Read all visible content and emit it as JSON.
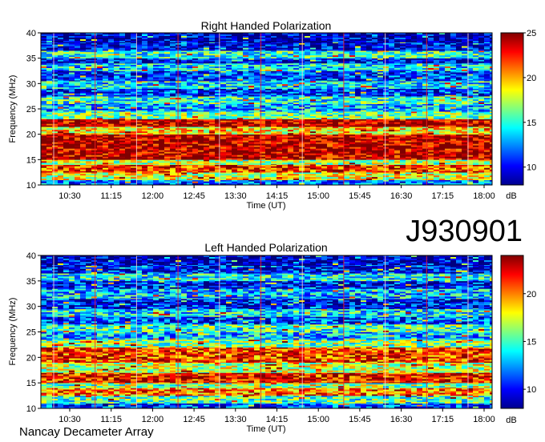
{
  "observation_id": "J930901",
  "footer_text": "Nancay Decameter Array",
  "chart_data": [
    {
      "type": "heatmap",
      "title": "Right Handed Polarization",
      "xlabel": "Time (UT)",
      "ylabel": "Frequency (MHz)",
      "xticks": [
        "10:30",
        "11:15",
        "12:00",
        "12:45",
        "13:30",
        "14:15",
        "15:00",
        "15:45",
        "16:30",
        "17:15",
        "18:00"
      ],
      "yticks": [
        10,
        15,
        20,
        25,
        30,
        35,
        40
      ],
      "ylim": [
        10,
        40
      ],
      "colorbar": {
        "label": "dB",
        "ticks": [
          10,
          15,
          20,
          25
        ],
        "range": [
          8,
          25
        ]
      },
      "colormap": "jet",
      "bands": [
        {
          "freq": [
            10,
            11
          ],
          "db": 12
        },
        {
          "freq": [
            11,
            12.5
          ],
          "db": 18
        },
        {
          "freq": [
            12.5,
            14
          ],
          "db": 22
        },
        {
          "freq": [
            14,
            15
          ],
          "db": 17
        },
        {
          "freq": [
            15,
            20
          ],
          "db": 24
        },
        {
          "freq": [
            20,
            21.5
          ],
          "db": 19
        },
        {
          "freq": [
            21.5,
            23
          ],
          "db": 24
        },
        {
          "freq": [
            23,
            24.5
          ],
          "db": 16
        },
        {
          "freq": [
            24.5,
            26
          ],
          "db": 13
        },
        {
          "freq": [
            26,
            27.5
          ],
          "db": 15
        },
        {
          "freq": [
            27.5,
            29
          ],
          "db": 11
        },
        {
          "freq": [
            29,
            30.5
          ],
          "db": 14
        },
        {
          "freq": [
            30.5,
            32.5
          ],
          "db": 11
        },
        {
          "freq": [
            32.5,
            34
          ],
          "db": 14
        },
        {
          "freq": [
            34,
            35
          ],
          "db": 10
        },
        {
          "freq": [
            35,
            36.5
          ],
          "db": 15
        },
        {
          "freq": [
            36.5,
            38
          ],
          "db": 10
        },
        {
          "freq": [
            38,
            40
          ],
          "db": 9
        }
      ]
    },
    {
      "type": "heatmap",
      "title": "Left Handed Polarization",
      "xlabel": "Time (UT)",
      "ylabel": "Frequency (MHz)",
      "xticks": [
        "10:30",
        "11:15",
        "12:00",
        "12:45",
        "13:30",
        "14:15",
        "15:00",
        "15:45",
        "16:30",
        "17:15",
        "18:00"
      ],
      "yticks": [
        10,
        15,
        20,
        25,
        30,
        35,
        40
      ],
      "ylim": [
        10,
        40
      ],
      "colorbar": {
        "label": "dB",
        "ticks": [
          10,
          15,
          20
        ],
        "range": [
          8,
          24
        ]
      },
      "colormap": "jet",
      "bands": [
        {
          "freq": [
            10,
            11
          ],
          "db": 11
        },
        {
          "freq": [
            11,
            12.5
          ],
          "db": 15
        },
        {
          "freq": [
            12.5,
            14
          ],
          "db": 20
        },
        {
          "freq": [
            14,
            15
          ],
          "db": 16
        },
        {
          "freq": [
            15,
            17
          ],
          "db": 22
        },
        {
          "freq": [
            17,
            19
          ],
          "db": 17
        },
        {
          "freq": [
            19,
            22
          ],
          "db": 21
        },
        {
          "freq": [
            22,
            23.5
          ],
          "db": 16
        },
        {
          "freq": [
            23.5,
            25
          ],
          "db": 13
        },
        {
          "freq": [
            25,
            26.5
          ],
          "db": 15
        },
        {
          "freq": [
            26.5,
            28
          ],
          "db": 11
        },
        {
          "freq": [
            28,
            29.5
          ],
          "db": 14
        },
        {
          "freq": [
            29.5,
            31.5
          ],
          "db": 10
        },
        {
          "freq": [
            31.5,
            33.5
          ],
          "db": 13
        },
        {
          "freq": [
            33.5,
            35
          ],
          "db": 10
        },
        {
          "freq": [
            35,
            36.5
          ],
          "db": 14
        },
        {
          "freq": [
            36.5,
            38
          ],
          "db": 10
        },
        {
          "freq": [
            38,
            40
          ],
          "db": 9
        }
      ]
    }
  ]
}
